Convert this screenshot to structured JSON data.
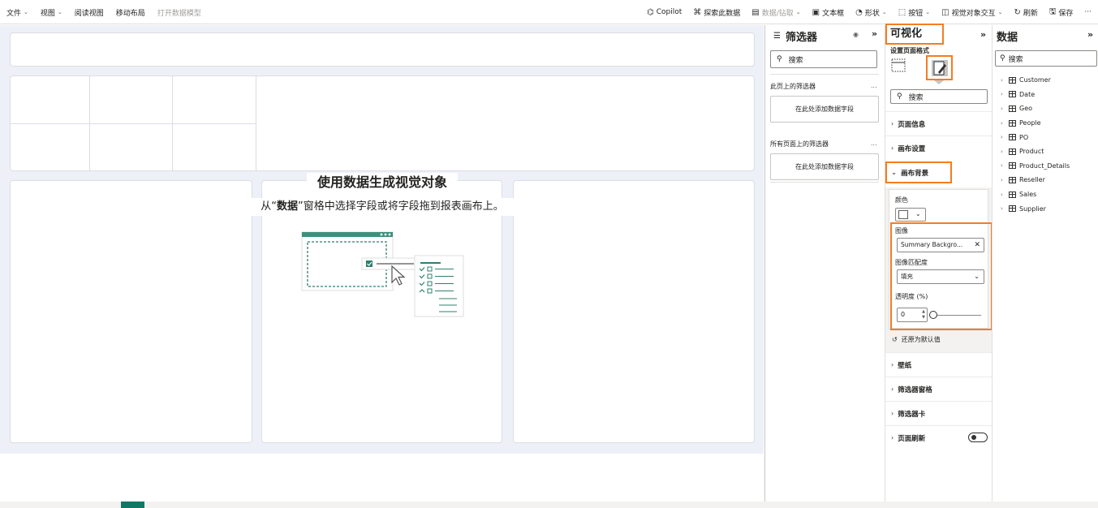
{
  "toolbar": {
    "left": [
      {
        "label": "文件",
        "chevron": true
      },
      {
        "label": "视图",
        "chevron": true
      },
      {
        "label": "阅读视图"
      },
      {
        "label": "移动布局"
      },
      {
        "label": "打开数据模型",
        "disabled": true
      }
    ],
    "right": [
      {
        "label": "Copilot",
        "icon": "copilot-icon"
      },
      {
        "label": "探索此数据",
        "icon": "binoculars-icon"
      },
      {
        "label": "数据/钻取",
        "icon": "drill-icon",
        "chevron": true,
        "disabled": true
      },
      {
        "label": "文本框",
        "icon": "textbox-icon"
      },
      {
        "label": "形状",
        "icon": "shapes-icon",
        "chevron": true
      },
      {
        "label": "按钮",
        "icon": "button-icon",
        "chevron": true
      },
      {
        "label": "视觉对象交互",
        "icon": "visual-interaction-icon",
        "chevron": true
      },
      {
        "label": "刷新",
        "icon": "refresh-icon"
      },
      {
        "label": "保存",
        "icon": "save-icon"
      },
      {
        "label": "···",
        "icon": "more-icon"
      }
    ]
  },
  "canvas": {
    "empty_title": "使用数据生成视觉对象",
    "empty_sub_prefix": "从“",
    "empty_sub_bold": "数据",
    "empty_sub_suffix": "”窗格中选择字段或将字段拖到报表画布上。"
  },
  "filters": {
    "title": "筛选器",
    "search_placeholder": "搜索",
    "this_page_label": "此页上的筛选器",
    "all_pages_label": "所有页面上的筛选器",
    "add_field": "在此处添加数据字段",
    "more": "..."
  },
  "viz": {
    "title": "可视化",
    "format_page_label": "设置页面格式",
    "search_placeholder": "搜索",
    "sections": {
      "page_info": "页面信息",
      "canvas_settings": "画布设置",
      "canvas_background": "画布背景",
      "wallpaper": "壁纸",
      "filter_pane": "筛选器窗格",
      "filter_cards": "筛选器卡",
      "page_refresh": "页面刷新"
    },
    "canvas_bg": {
      "color_label": "颜色",
      "color_value": "#ffffff",
      "image_label": "图像",
      "image_value": "Summary Backgro...",
      "fit_label": "图像匹配度",
      "fit_value": "填充",
      "transparency_label": "透明度 (%)",
      "transparency_value": "0",
      "reset_label": "还原为默认值"
    },
    "page_refresh_on": false
  },
  "data_pane": {
    "title": "数据",
    "search_placeholder": "搜索",
    "tables": [
      "Customer",
      "Date",
      "Geo",
      "People",
      "PO",
      "Product",
      "Product_Details",
      "Reseller",
      "Sales",
      "Supplier"
    ]
  },
  "colors": {
    "highlight": "#f47c21",
    "accent": "#117865",
    "canvas_bg": "#eef0f8"
  }
}
